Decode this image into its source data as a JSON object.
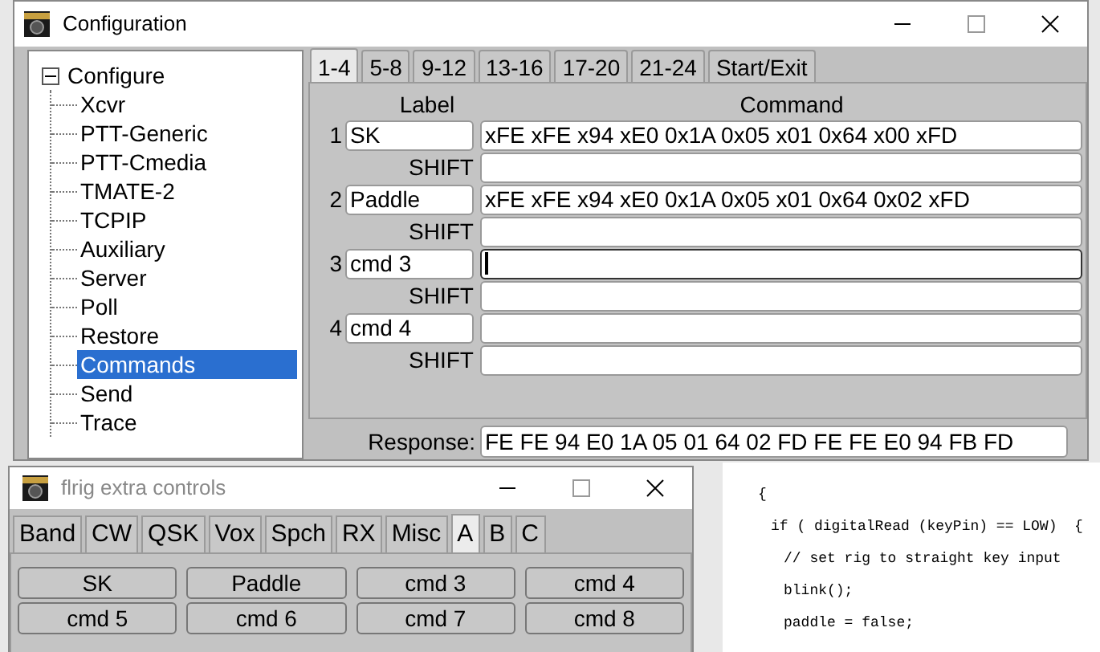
{
  "config_window": {
    "title": "Configuration",
    "tree": {
      "label": "Configure",
      "expanded": true,
      "children": [
        {
          "label": "Xcvr",
          "selected": false
        },
        {
          "label": "PTT-Generic",
          "selected": false
        },
        {
          "label": "PTT-Cmedia",
          "selected": false
        },
        {
          "label": "TMATE-2",
          "selected": false
        },
        {
          "label": "TCPIP",
          "selected": false
        },
        {
          "label": "Auxiliary",
          "selected": false
        },
        {
          "label": "Server",
          "selected": false
        },
        {
          "label": "Poll",
          "selected": false
        },
        {
          "label": "Restore",
          "selected": false
        },
        {
          "label": "Commands",
          "selected": true
        },
        {
          "label": "Send",
          "selected": false
        },
        {
          "label": "Trace",
          "selected": false
        }
      ]
    },
    "tabs": [
      {
        "label": "1-4",
        "selected": true
      },
      {
        "label": "5-8",
        "selected": false
      },
      {
        "label": "9-12",
        "selected": false
      },
      {
        "label": "13-16",
        "selected": false
      },
      {
        "label": "17-20",
        "selected": false
      },
      {
        "label": "21-24",
        "selected": false
      },
      {
        "label": "Start/Exit",
        "selected": false
      }
    ],
    "columns": [
      "Label",
      "Command"
    ],
    "commands": [
      {
        "number": "1",
        "label": "SK",
        "command": "xFE xFE x94 xE0 0x1A 0x05 x01 0x64 x00 xFD",
        "focused": false,
        "shift_label": "SHIFT"
      },
      {
        "number": "2",
        "label": "Paddle",
        "command": "xFE xFE x94 xE0 0x1A 0x05 x01 0x64 0x02 xFD",
        "focused": false,
        "shift_label": "SHIFT"
      },
      {
        "number": "3",
        "label": "cmd 3",
        "focused": true,
        "shift_label": "SHIFT"
      },
      {
        "number": "4",
        "label": "cmd 4",
        "focused": false,
        "shift_label": "SHIFT"
      }
    ],
    "response": {
      "label": "Response:",
      "value": "FE FE 94 E0 1A 05 01 64 02 FD FE FE E0 94 FB FD"
    }
  },
  "extra_window": {
    "title": "flrig extra controls",
    "tabs": [
      {
        "label": "Band",
        "selected": false
      },
      {
        "label": "CW",
        "selected": false
      },
      {
        "label": "QSK",
        "selected": false
      },
      {
        "label": "Vox",
        "selected": false
      },
      {
        "label": "Spch",
        "selected": false
      },
      {
        "label": "RX",
        "selected": false
      },
      {
        "label": "Misc",
        "selected": false
      },
      {
        "label": "A",
        "selected": true
      },
      {
        "label": "B",
        "selected": false
      },
      {
        "label": "C",
        "selected": false
      }
    ],
    "buttons": [
      "SK",
      "Paddle",
      "cmd 3",
      "cmd 4",
      "cmd 5",
      "cmd 6",
      "cmd 7",
      "cmd 8"
    ]
  },
  "code_lines": [
    {
      "text": "{",
      "children": [
        {
          "text": "if ( digitalRead (keyPin) == LOW)  {",
          "children": [
            {
              "text": "// set rig to straight key input"
            },
            {
              "text": "blink();"
            },
            {
              "text": "paddle = false;"
            }
          ]
        }
      ]
    }
  ]
}
